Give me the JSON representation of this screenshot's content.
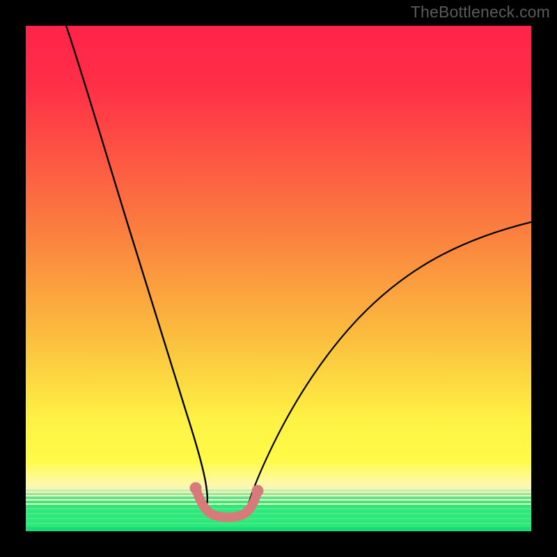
{
  "watermark": "TheBottleneck.com",
  "colors": {
    "red": "#ff2349",
    "orange": "#fca23b",
    "yellow": "#fffb47",
    "paleYellow": "#fdf9a8",
    "green_mid": "#2ee97a",
    "green_low": "#18db79",
    "curve": "#000000",
    "marker": "#d87a7a",
    "marker_stroke": "#d37070"
  },
  "chart_data": {
    "type": "line",
    "title": "",
    "xlabel": "",
    "ylabel": "",
    "xlim": [
      0,
      100
    ],
    "ylim": [
      0,
      100
    ],
    "series": [
      {
        "name": "left-curve",
        "x": [
          8,
          10,
          14,
          18,
          22,
          26,
          30,
          32,
          34,
          35.5
        ],
        "values": [
          100,
          93,
          79,
          65,
          51,
          37.5,
          24,
          17,
          10,
          5.5
        ]
      },
      {
        "name": "right-curve",
        "x": [
          44,
          45,
          47,
          50,
          54,
          60,
          66,
          72,
          78,
          86,
          94,
          100
        ],
        "values": [
          5.5,
          7,
          10.5,
          15,
          20.5,
          28,
          34.5,
          40,
          45,
          51,
          56.5,
          61
        ]
      },
      {
        "name": "bottom-highlight",
        "x": [
          33.5,
          34,
          34.7,
          35.5,
          36.5,
          38,
          40,
          42,
          43.5,
          44.3,
          45,
          45.5
        ],
        "values": [
          8.5,
          7,
          5.5,
          4.2,
          3.4,
          2.9,
          2.8,
          2.9,
          3.4,
          4.5,
          6,
          7.8
        ]
      }
    ],
    "gradient_bands": [
      {
        "from": 100,
        "to": 24,
        "color_top": "#ff2349",
        "color_bottom": "#fca23b"
      },
      {
        "from": 24,
        "to": 14,
        "color_top": "#fca23b",
        "color_bottom": "#fffb47"
      },
      {
        "from": 14,
        "to": 9,
        "color_top": "#fffb47",
        "color_bottom": "#fdf9a8"
      },
      {
        "from": 9,
        "to": 0,
        "color_top": "#fdf9a8",
        "color_bottom": "#18db79"
      }
    ]
  }
}
